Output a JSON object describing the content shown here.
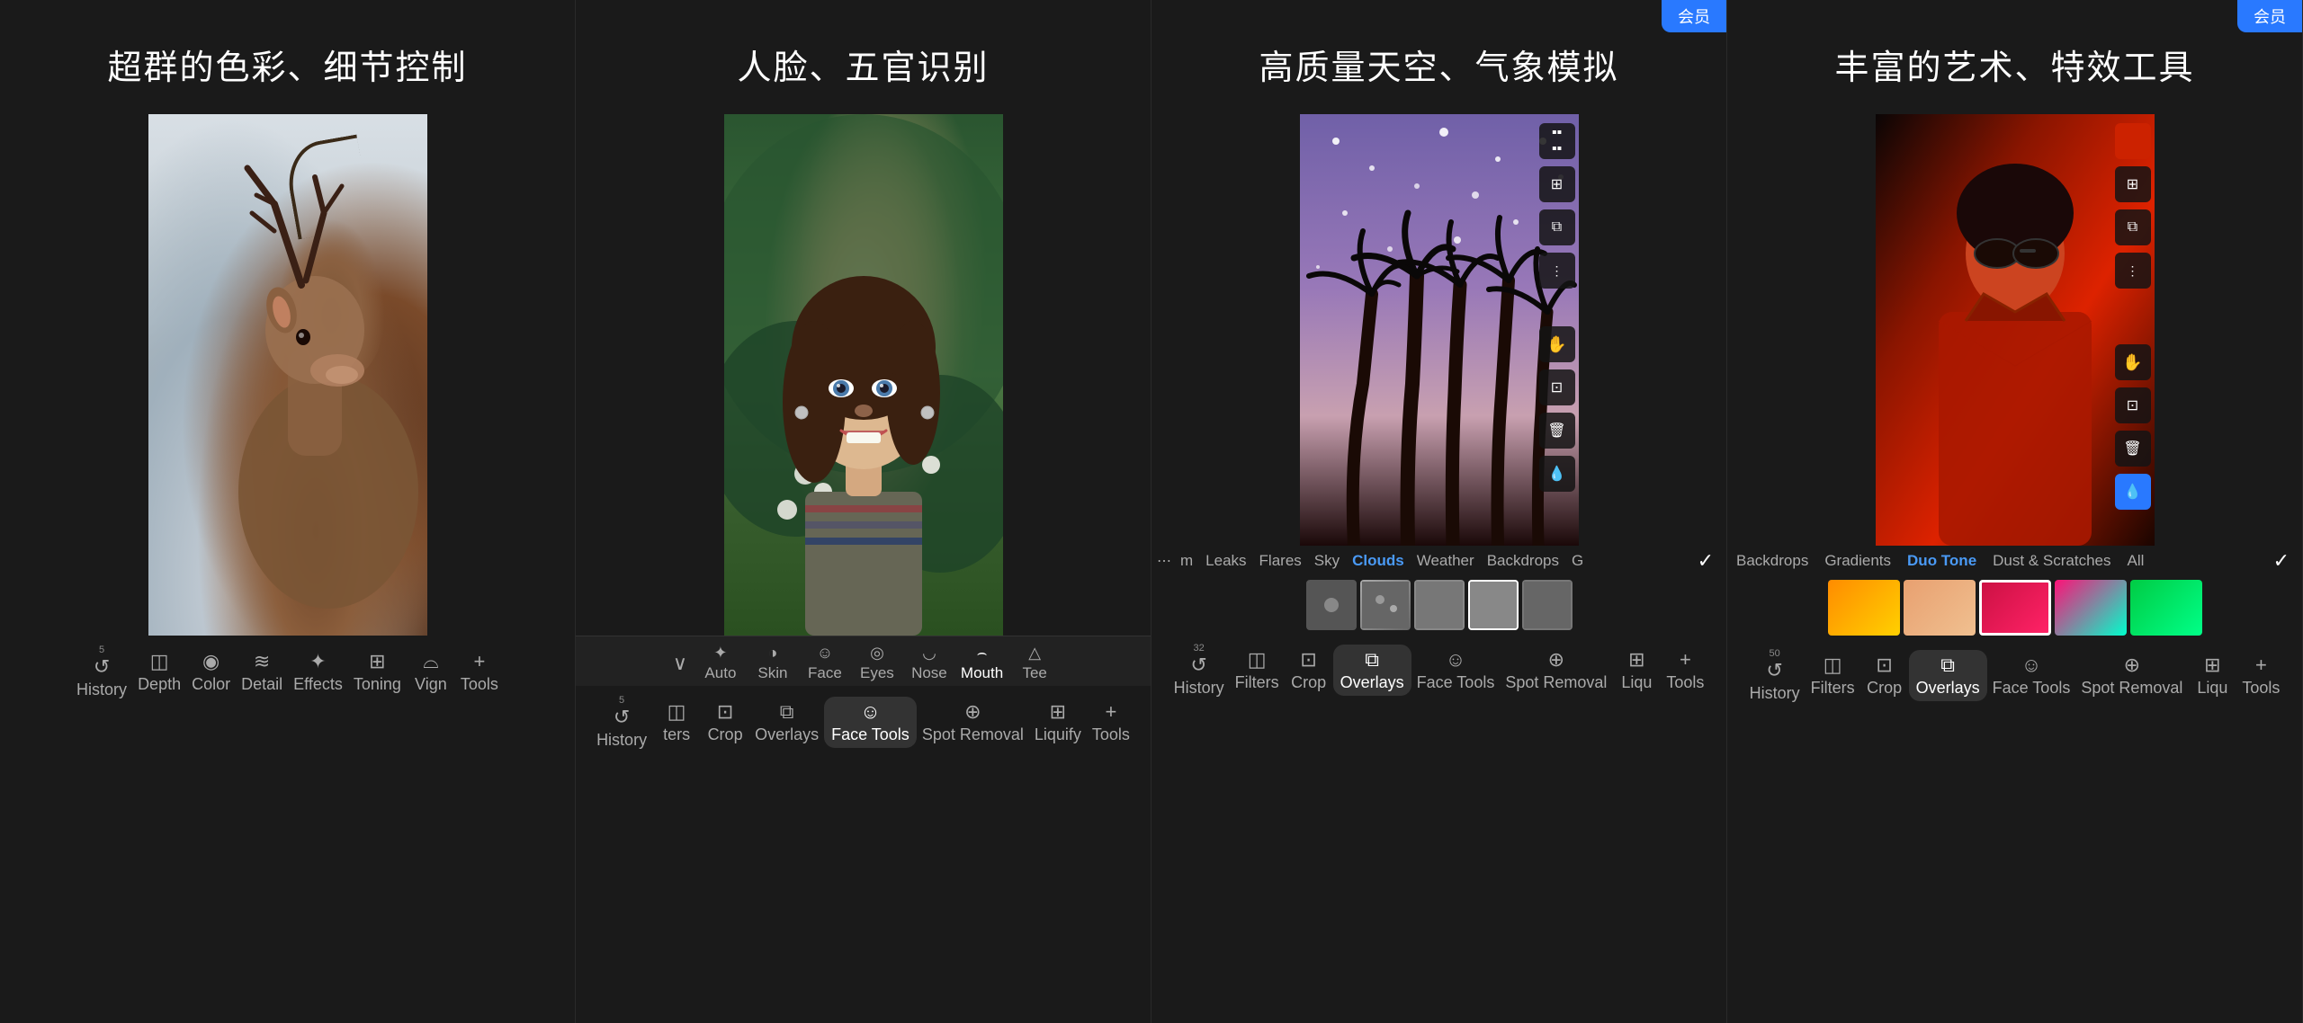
{
  "panels": [
    {
      "id": "panel1",
      "title": "超群的色彩、细节控制",
      "image_type": "deer",
      "toolbar_items": [
        {
          "id": "history",
          "label": "History",
          "icon": "↺",
          "badge": "5"
        },
        {
          "id": "depth",
          "label": "Depth",
          "icon": "◫"
        },
        {
          "id": "color",
          "label": "Color",
          "icon": "◉"
        },
        {
          "id": "detail",
          "label": "Detail",
          "icon": "≋"
        },
        {
          "id": "effects",
          "label": "Effects",
          "icon": "✦"
        },
        {
          "id": "toning",
          "label": "Toning",
          "icon": "⊞"
        },
        {
          "id": "vign",
          "label": "Vign",
          "icon": "⌓"
        },
        {
          "id": "tools",
          "label": "Tools",
          "icon": "+"
        }
      ]
    },
    {
      "id": "panel2",
      "title": "人脸、五官识别",
      "image_type": "girl",
      "sub_toolbar": [
        {
          "id": "auto",
          "label": "Auto",
          "icon": "✦"
        },
        {
          "id": "skin",
          "label": "Skin",
          "icon": "◑"
        },
        {
          "id": "face",
          "label": "Face",
          "icon": "☺"
        },
        {
          "id": "eyes",
          "label": "Eyes",
          "icon": "◎"
        },
        {
          "id": "nose",
          "label": "Nose",
          "icon": "◡"
        },
        {
          "id": "mouth",
          "label": "Mouth",
          "icon": "⌢"
        },
        {
          "id": "tee",
          "label": "Tee",
          "icon": "△"
        }
      ],
      "toolbar_items": [
        {
          "id": "history",
          "label": "History",
          "icon": "↺",
          "badge": "5"
        },
        {
          "id": "filters",
          "label": "ters",
          "icon": "◫"
        },
        {
          "id": "crop",
          "label": "Crop",
          "icon": "⊡"
        },
        {
          "id": "overlays",
          "label": "Overlays",
          "icon": "⧉"
        },
        {
          "id": "face-tools",
          "label": "Face Tools",
          "icon": "☺",
          "active": true
        },
        {
          "id": "spot-removal",
          "label": "Spot Removal",
          "icon": "⊕"
        },
        {
          "id": "liquify",
          "label": "Liquify",
          "icon": "⊞"
        },
        {
          "id": "tools",
          "label": "Tools",
          "icon": "+"
        }
      ]
    },
    {
      "id": "panel3",
      "title": "高质量天空、气象模拟",
      "image_type": "sky",
      "filter_tabs": [
        "m",
        "Leaks",
        "Flares",
        "Sky",
        "Clouds",
        "Weather",
        "Backdrops",
        "G"
      ],
      "active_filter": "Clouds",
      "toolbar_items": [
        {
          "id": "history",
          "label": "History",
          "icon": "↺",
          "badge": "32"
        },
        {
          "id": "filters",
          "label": "Filters",
          "icon": "◫"
        },
        {
          "id": "crop",
          "label": "Crop",
          "icon": "⊡"
        },
        {
          "id": "overlays",
          "label": "Overlays",
          "icon": "⧉",
          "active": true
        },
        {
          "id": "face-tools",
          "label": "Face Tools",
          "icon": "☺"
        },
        {
          "id": "spot-removal",
          "label": "Spot Removal",
          "icon": "⊕"
        },
        {
          "id": "liqu",
          "label": "Liqu",
          "icon": "⊞"
        },
        {
          "id": "tools",
          "label": "Tools",
          "icon": "+"
        }
      ]
    },
    {
      "id": "panel4",
      "title": "丰富的艺术、特效工具",
      "image_type": "red",
      "filter_tabs": [
        "Backdrops",
        "Gradients",
        "Duo Tone",
        "Dust & Scratches",
        "All"
      ],
      "active_filter": "Duo Tone",
      "swatches": [
        {
          "id": "orange",
          "gradient": "linear-gradient(135deg, #ff8c00, #ffd000)"
        },
        {
          "id": "peach",
          "gradient": "linear-gradient(135deg, #e8a070, #f0c090)"
        },
        {
          "id": "red-pink",
          "gradient": "linear-gradient(135deg, #cc1144, #ff2266)",
          "active": true
        },
        {
          "id": "pink-cyan",
          "gradient": "linear-gradient(135deg, #ff1177, #00ffcc)"
        },
        {
          "id": "green",
          "gradient": "linear-gradient(135deg, #00cc44, #00ff88)"
        }
      ],
      "toolbar_items": [
        {
          "id": "history",
          "label": "History",
          "icon": "↺",
          "badge": "50"
        },
        {
          "id": "filters",
          "label": "Filters",
          "icon": "◫"
        },
        {
          "id": "crop",
          "label": "Crop",
          "icon": "⊡"
        },
        {
          "id": "overlays",
          "label": "Overlays",
          "icon": "⧉",
          "active": true
        },
        {
          "id": "face-tools",
          "label": "Face Tools",
          "icon": "☺"
        },
        {
          "id": "spot-removal",
          "label": "Spot Removal",
          "icon": "⊕"
        },
        {
          "id": "liqu",
          "label": "Liqu",
          "icon": "⊞"
        },
        {
          "id": "tools",
          "label": "Tools",
          "icon": "+"
        }
      ]
    }
  ],
  "tag_label": "会员",
  "side_buttons": {
    "texture": "▪",
    "grid": "⊞",
    "copy": "⧉",
    "more": "⋮",
    "hand": "✋",
    "transform": "⊡",
    "delete": "🗑",
    "eyedrop": "💧"
  }
}
